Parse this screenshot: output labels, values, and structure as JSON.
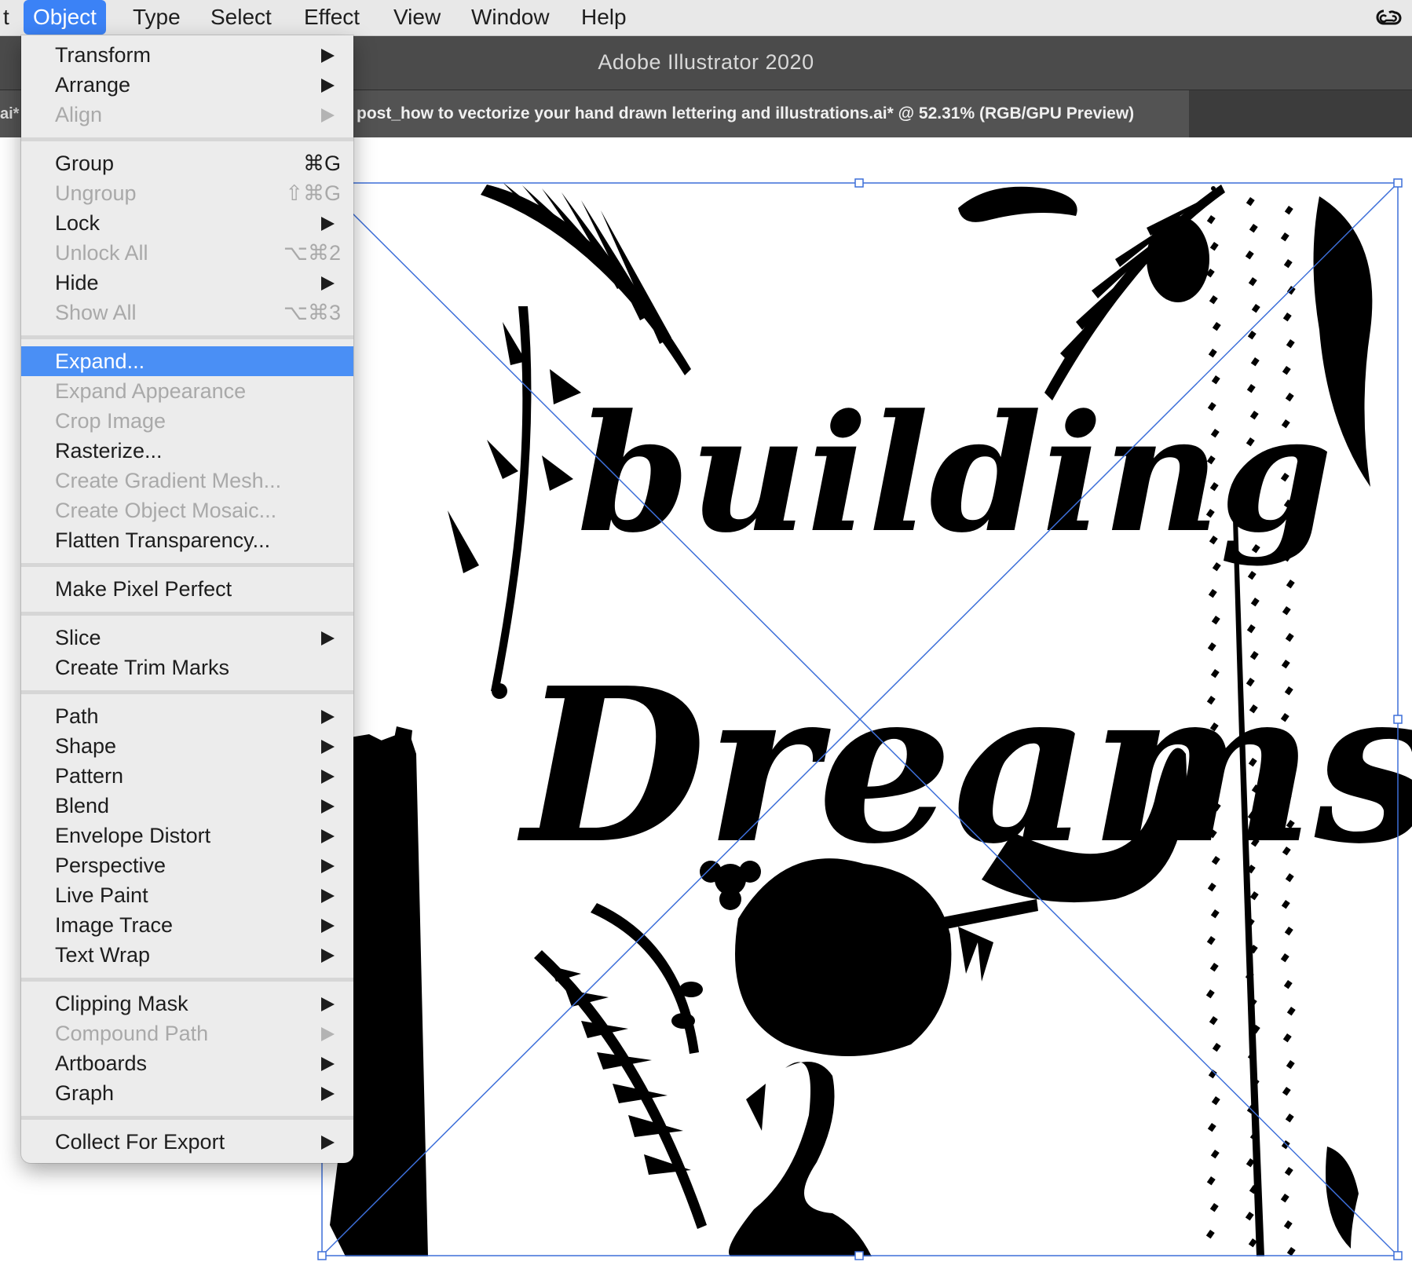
{
  "menubar": {
    "items": [
      {
        "label": "t"
      },
      {
        "label": "Object"
      },
      {
        "label": "Type"
      },
      {
        "label": "Select"
      },
      {
        "label": "Effect"
      },
      {
        "label": "View"
      },
      {
        "label": "Window"
      },
      {
        "label": "Help"
      }
    ],
    "right_icon": "creative-cloud-icon"
  },
  "app": {
    "title": "Adobe Illustrator 2020"
  },
  "tabs": {
    "left_partial": "ai*",
    "active": "post_how to vectorize your hand drawn lettering and illustrations.ai* @ 52.31% (RGB/GPU Preview)"
  },
  "menu": {
    "items": [
      {
        "label": "Transform",
        "submenu": true
      },
      {
        "label": "Arrange",
        "submenu": true
      },
      {
        "label": "Align",
        "submenu": true,
        "disabled": true
      },
      {
        "label": "Group",
        "shortcut": "⌘G"
      },
      {
        "label": "Ungroup",
        "shortcut": "⇧⌘G",
        "disabled": true
      },
      {
        "label": "Lock",
        "submenu": true
      },
      {
        "label": "Unlock All",
        "shortcut": "⌥⌘2",
        "disabled": true
      },
      {
        "label": "Hide",
        "submenu": true
      },
      {
        "label": "Show All",
        "shortcut": "⌥⌘3",
        "disabled": true
      },
      {
        "label": "Expand...",
        "highlighted": true
      },
      {
        "label": "Expand Appearance",
        "disabled": true
      },
      {
        "label": "Crop Image",
        "disabled": true
      },
      {
        "label": "Rasterize..."
      },
      {
        "label": "Create Gradient Mesh...",
        "disabled": true
      },
      {
        "label": "Create Object Mosaic...",
        "disabled": true
      },
      {
        "label": "Flatten Transparency..."
      },
      {
        "label": "Make Pixel Perfect"
      },
      {
        "label": "Slice",
        "submenu": true
      },
      {
        "label": "Create Trim Marks"
      },
      {
        "label": "Path",
        "submenu": true
      },
      {
        "label": "Shape",
        "submenu": true
      },
      {
        "label": "Pattern",
        "submenu": true
      },
      {
        "label": "Blend",
        "submenu": true
      },
      {
        "label": "Envelope Distort",
        "submenu": true
      },
      {
        "label": "Perspective",
        "submenu": true
      },
      {
        "label": "Live Paint",
        "submenu": true
      },
      {
        "label": "Image Trace",
        "submenu": true
      },
      {
        "label": "Text Wrap",
        "submenu": true
      },
      {
        "label": "Clipping Mask",
        "submenu": true
      },
      {
        "label": "Compound Path",
        "submenu": true,
        "disabled": true
      },
      {
        "label": "Artboards",
        "submenu": true
      },
      {
        "label": "Graph",
        "submenu": true
      },
      {
        "label": "Collect For Export",
        "submenu": true
      }
    ]
  },
  "artwork": {
    "line1": "building",
    "line2": "Dreams",
    "selection_color": "#3d6fd9"
  }
}
